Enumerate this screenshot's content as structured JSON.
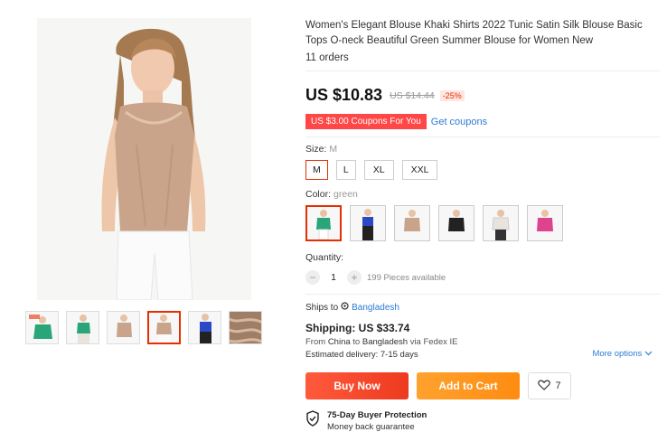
{
  "product": {
    "title": "Women's Elegant Blouse Khaki Shirts 2022 Tunic Satin Silk Blouse Basic Tops O-neck Beautiful Green Summer Blouse for Women New",
    "orders": "11 orders",
    "price": "US $10.83",
    "old_price": "US $14.44",
    "discount": "-25%",
    "coupon_tag": "US $3.00 Coupons For You",
    "get_coupons": "Get coupons"
  },
  "size": {
    "label": "Size:",
    "selected": "M",
    "options": [
      "M",
      "L",
      "XL",
      "XXL"
    ]
  },
  "color": {
    "label": "Color:",
    "selected": "green",
    "swatches": [
      "green",
      "blue",
      "khaki",
      "black",
      "white",
      "pink"
    ],
    "swatch_hex": [
      "#2aa57a",
      "#2b49c7",
      "#c9a48a",
      "#222222",
      "#e8e4dc",
      "#e0438e"
    ]
  },
  "quantity": {
    "label": "Quantity:",
    "value": "1",
    "minus": "−",
    "plus": "+",
    "available": "199 Pieces available"
  },
  "shipping": {
    "ships_to_label": "Ships to",
    "destination": "Bangladesh",
    "title": "Shipping: US $33.74",
    "route_prefix": "From",
    "route_from": "China",
    "route_to_word": "to",
    "route_to": "Bangladesh",
    "route_via": "via Fedex IE",
    "delivery": "Estimated delivery: 7-15 days",
    "more_options": "More options"
  },
  "actions": {
    "buy_now": "Buy Now",
    "add_to_cart": "Add to Cart",
    "wishlist_count": "7"
  },
  "protection": {
    "title": "75-Day Buyer Protection",
    "subtitle": "Money back guarantee"
  },
  "gallery": {
    "thumb_colors": [
      "#2aa57a",
      "#e8e4dc",
      "#c9a48a",
      "#c9a48a",
      "#222222",
      "#a07e66"
    ]
  },
  "colors": {
    "accent_red": "#e62e04",
    "link_blue": "#2e7bd5",
    "buy_now": "#ee3a1f",
    "add_to_cart": "#ff8c11"
  }
}
